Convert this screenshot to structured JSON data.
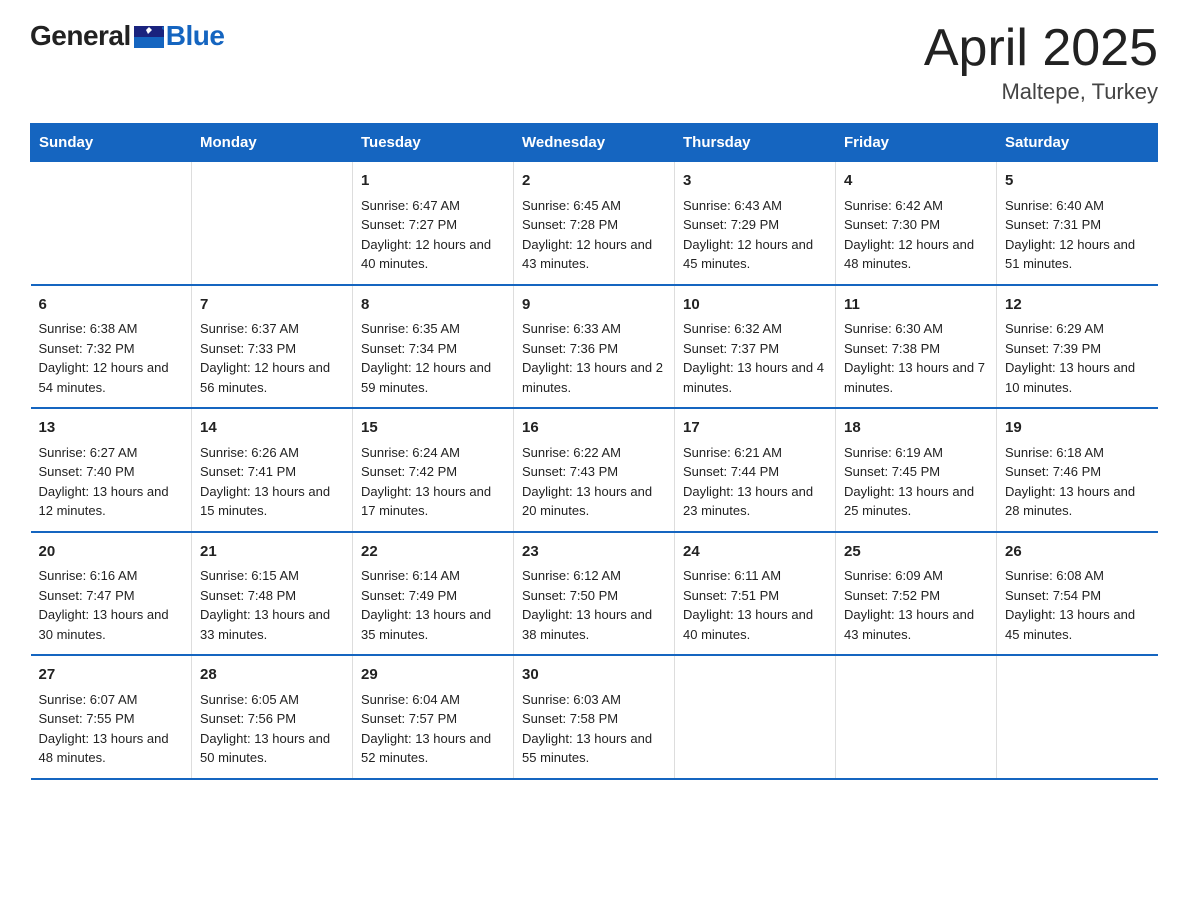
{
  "header": {
    "logo_general": "General",
    "logo_blue": "Blue",
    "title": "April 2025",
    "location": "Maltepe, Turkey"
  },
  "calendar": {
    "days_of_week": [
      "Sunday",
      "Monday",
      "Tuesday",
      "Wednesday",
      "Thursday",
      "Friday",
      "Saturday"
    ],
    "weeks": [
      [
        {
          "day": "",
          "sunrise": "",
          "sunset": "",
          "daylight": ""
        },
        {
          "day": "",
          "sunrise": "",
          "sunset": "",
          "daylight": ""
        },
        {
          "day": "1",
          "sunrise": "Sunrise: 6:47 AM",
          "sunset": "Sunset: 7:27 PM",
          "daylight": "Daylight: 12 hours and 40 minutes."
        },
        {
          "day": "2",
          "sunrise": "Sunrise: 6:45 AM",
          "sunset": "Sunset: 7:28 PM",
          "daylight": "Daylight: 12 hours and 43 minutes."
        },
        {
          "day": "3",
          "sunrise": "Sunrise: 6:43 AM",
          "sunset": "Sunset: 7:29 PM",
          "daylight": "Daylight: 12 hours and 45 minutes."
        },
        {
          "day": "4",
          "sunrise": "Sunrise: 6:42 AM",
          "sunset": "Sunset: 7:30 PM",
          "daylight": "Daylight: 12 hours and 48 minutes."
        },
        {
          "day": "5",
          "sunrise": "Sunrise: 6:40 AM",
          "sunset": "Sunset: 7:31 PM",
          "daylight": "Daylight: 12 hours and 51 minutes."
        }
      ],
      [
        {
          "day": "6",
          "sunrise": "Sunrise: 6:38 AM",
          "sunset": "Sunset: 7:32 PM",
          "daylight": "Daylight: 12 hours and 54 minutes."
        },
        {
          "day": "7",
          "sunrise": "Sunrise: 6:37 AM",
          "sunset": "Sunset: 7:33 PM",
          "daylight": "Daylight: 12 hours and 56 minutes."
        },
        {
          "day": "8",
          "sunrise": "Sunrise: 6:35 AM",
          "sunset": "Sunset: 7:34 PM",
          "daylight": "Daylight: 12 hours and 59 minutes."
        },
        {
          "day": "9",
          "sunrise": "Sunrise: 6:33 AM",
          "sunset": "Sunset: 7:36 PM",
          "daylight": "Daylight: 13 hours and 2 minutes."
        },
        {
          "day": "10",
          "sunrise": "Sunrise: 6:32 AM",
          "sunset": "Sunset: 7:37 PM",
          "daylight": "Daylight: 13 hours and 4 minutes."
        },
        {
          "day": "11",
          "sunrise": "Sunrise: 6:30 AM",
          "sunset": "Sunset: 7:38 PM",
          "daylight": "Daylight: 13 hours and 7 minutes."
        },
        {
          "day": "12",
          "sunrise": "Sunrise: 6:29 AM",
          "sunset": "Sunset: 7:39 PM",
          "daylight": "Daylight: 13 hours and 10 minutes."
        }
      ],
      [
        {
          "day": "13",
          "sunrise": "Sunrise: 6:27 AM",
          "sunset": "Sunset: 7:40 PM",
          "daylight": "Daylight: 13 hours and 12 minutes."
        },
        {
          "day": "14",
          "sunrise": "Sunrise: 6:26 AM",
          "sunset": "Sunset: 7:41 PM",
          "daylight": "Daylight: 13 hours and 15 minutes."
        },
        {
          "day": "15",
          "sunrise": "Sunrise: 6:24 AM",
          "sunset": "Sunset: 7:42 PM",
          "daylight": "Daylight: 13 hours and 17 minutes."
        },
        {
          "day": "16",
          "sunrise": "Sunrise: 6:22 AM",
          "sunset": "Sunset: 7:43 PM",
          "daylight": "Daylight: 13 hours and 20 minutes."
        },
        {
          "day": "17",
          "sunrise": "Sunrise: 6:21 AM",
          "sunset": "Sunset: 7:44 PM",
          "daylight": "Daylight: 13 hours and 23 minutes."
        },
        {
          "day": "18",
          "sunrise": "Sunrise: 6:19 AM",
          "sunset": "Sunset: 7:45 PM",
          "daylight": "Daylight: 13 hours and 25 minutes."
        },
        {
          "day": "19",
          "sunrise": "Sunrise: 6:18 AM",
          "sunset": "Sunset: 7:46 PM",
          "daylight": "Daylight: 13 hours and 28 minutes."
        }
      ],
      [
        {
          "day": "20",
          "sunrise": "Sunrise: 6:16 AM",
          "sunset": "Sunset: 7:47 PM",
          "daylight": "Daylight: 13 hours and 30 minutes."
        },
        {
          "day": "21",
          "sunrise": "Sunrise: 6:15 AM",
          "sunset": "Sunset: 7:48 PM",
          "daylight": "Daylight: 13 hours and 33 minutes."
        },
        {
          "day": "22",
          "sunrise": "Sunrise: 6:14 AM",
          "sunset": "Sunset: 7:49 PM",
          "daylight": "Daylight: 13 hours and 35 minutes."
        },
        {
          "day": "23",
          "sunrise": "Sunrise: 6:12 AM",
          "sunset": "Sunset: 7:50 PM",
          "daylight": "Daylight: 13 hours and 38 minutes."
        },
        {
          "day": "24",
          "sunrise": "Sunrise: 6:11 AM",
          "sunset": "Sunset: 7:51 PM",
          "daylight": "Daylight: 13 hours and 40 minutes."
        },
        {
          "day": "25",
          "sunrise": "Sunrise: 6:09 AM",
          "sunset": "Sunset: 7:52 PM",
          "daylight": "Daylight: 13 hours and 43 minutes."
        },
        {
          "day": "26",
          "sunrise": "Sunrise: 6:08 AM",
          "sunset": "Sunset: 7:54 PM",
          "daylight": "Daylight: 13 hours and 45 minutes."
        }
      ],
      [
        {
          "day": "27",
          "sunrise": "Sunrise: 6:07 AM",
          "sunset": "Sunset: 7:55 PM",
          "daylight": "Daylight: 13 hours and 48 minutes."
        },
        {
          "day": "28",
          "sunrise": "Sunrise: 6:05 AM",
          "sunset": "Sunset: 7:56 PM",
          "daylight": "Daylight: 13 hours and 50 minutes."
        },
        {
          "day": "29",
          "sunrise": "Sunrise: 6:04 AM",
          "sunset": "Sunset: 7:57 PM",
          "daylight": "Daylight: 13 hours and 52 minutes."
        },
        {
          "day": "30",
          "sunrise": "Sunrise: 6:03 AM",
          "sunset": "Sunset: 7:58 PM",
          "daylight": "Daylight: 13 hours and 55 minutes."
        },
        {
          "day": "",
          "sunrise": "",
          "sunset": "",
          "daylight": ""
        },
        {
          "day": "",
          "sunrise": "",
          "sunset": "",
          "daylight": ""
        },
        {
          "day": "",
          "sunrise": "",
          "sunset": "",
          "daylight": ""
        }
      ]
    ]
  }
}
